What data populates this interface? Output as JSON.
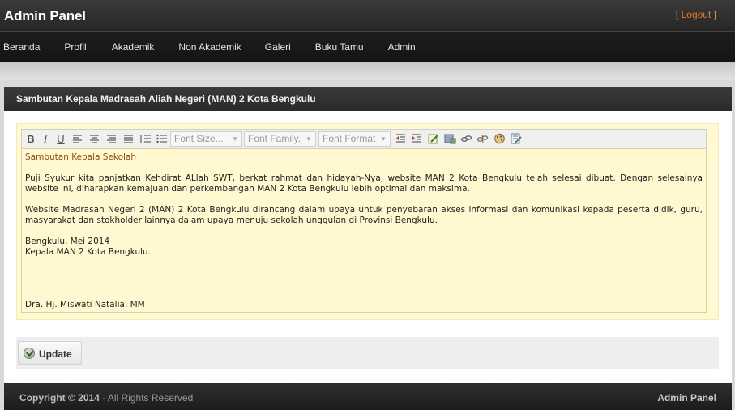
{
  "header": {
    "title": "Admin Panel",
    "logout_open": "[",
    "logout_label": "Logout",
    "logout_close": "]"
  },
  "nav": {
    "items": [
      "Beranda",
      "Profil",
      "Akademik",
      "Non Akademik",
      "Galeri",
      "Buku Tamu",
      "Admin"
    ]
  },
  "panel": {
    "title": "Sambutan Kepala Madrasah Aliah Negeri (MAN) 2 Kota Bengkulu"
  },
  "toolbar": {
    "font_size": "Font Size...",
    "font_family": "Font Family.",
    "font_format": "Font Format",
    "buttons": [
      "B",
      "I",
      "U"
    ]
  },
  "editor": {
    "heading": "Sambutan Kepala Sekolah",
    "p1": "Puji Syukur kita panjatkan Kehdirat ALlah SWT, berkat rahmat dan hidayah-Nya, website MAN 2 Kota Bengkulu telah selesai dibuat. Dengan selesainya website ini, diharapkan kemajuan dan perkembangan MAN 2 Kota Bengkulu lebih optimal dan maksima.",
    "p2": "Website Madrasah Negeri 2 (MAN) 2 Kota Bengkulu dirancang dalam upaya untuk penyebaran akses informasi dan komunikasi kepada peserta didik, guru, masyarakat dan stokholder lainnya dalam upaya menuju sekolah unggulan di Provinsi Bengkulu.",
    "place_date": "Bengkulu, Mei 2014",
    "position": "Kepala MAN 2 Kota Bengkulu..",
    "signature": "Dra. Hj. Miswati Natalia, MM"
  },
  "actions": {
    "update_label": "Update"
  },
  "footer": {
    "copyright": "Copyright © 2014",
    "rights": " - All Rights Reserved",
    "brand": "Admin Panel"
  }
}
